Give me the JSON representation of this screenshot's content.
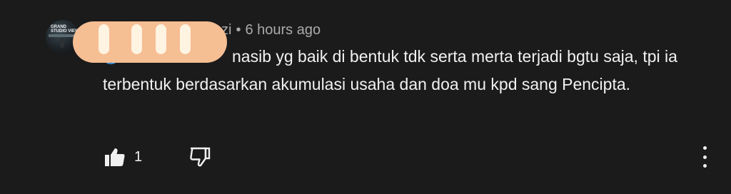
{
  "comment": {
    "author_suffix": "zi",
    "separator": "•",
    "timestamp": "6 hours ago",
    "mention": "@",
    "text": "nasib yg baik di bentuk tdk serta merta terjadi bgtu saja, tpi ia terbentuk berdasarkan akumulasi usaha dan doa mu kpd sang Pencipta.",
    "avatar_text": [
      "GRAND",
      "STUDIO VIEW"
    ]
  },
  "actions": {
    "like_icon": "thumbs-up-icon",
    "like_count": "1",
    "dislike_icon": "thumbs-down-icon",
    "more_icon": "more-vertical-icon"
  },
  "colors": {
    "background": "#1b1b1b",
    "text": "#f1f1f1",
    "secondary_text": "#aaaaaa",
    "mention": "#3ea6ff",
    "redaction": "#f6be93"
  }
}
